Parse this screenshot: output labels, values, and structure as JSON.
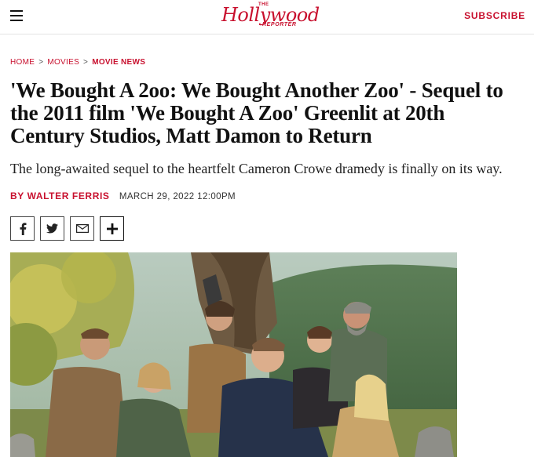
{
  "header": {
    "logo": {
      "the": "THE",
      "name": "Hollywood",
      "sub": "REPORTER"
    },
    "subscribe_label": "SUBSCRIBE",
    "menu_icon": "hamburger-menu-icon"
  },
  "breadcrumb": {
    "items": [
      "HOME",
      "MOVIES",
      "MOVIE NEWS"
    ],
    "separator": ">"
  },
  "article": {
    "headline": "'We Bought A 2oo: We Bought Another Zoo' - Sequel to the 2011 film 'We Bought A Zoo' Greenlit at 20th Century Studios, Matt Damon to Return",
    "dek": "The long-awaited sequel to the heartfelt Cameron Crowe dramedy is finally on its way.",
    "author": "BY WALTER FERRIS",
    "date": "MARCH 29, 2022 12:00PM"
  },
  "share_buttons": [
    {
      "icon": "facebook-icon"
    },
    {
      "icon": "twitter-icon"
    },
    {
      "icon": "email-icon"
    },
    {
      "icon": "plus-icon"
    }
  ],
  "colors": {
    "brand_red": "#c8102e",
    "text": "#111111"
  }
}
